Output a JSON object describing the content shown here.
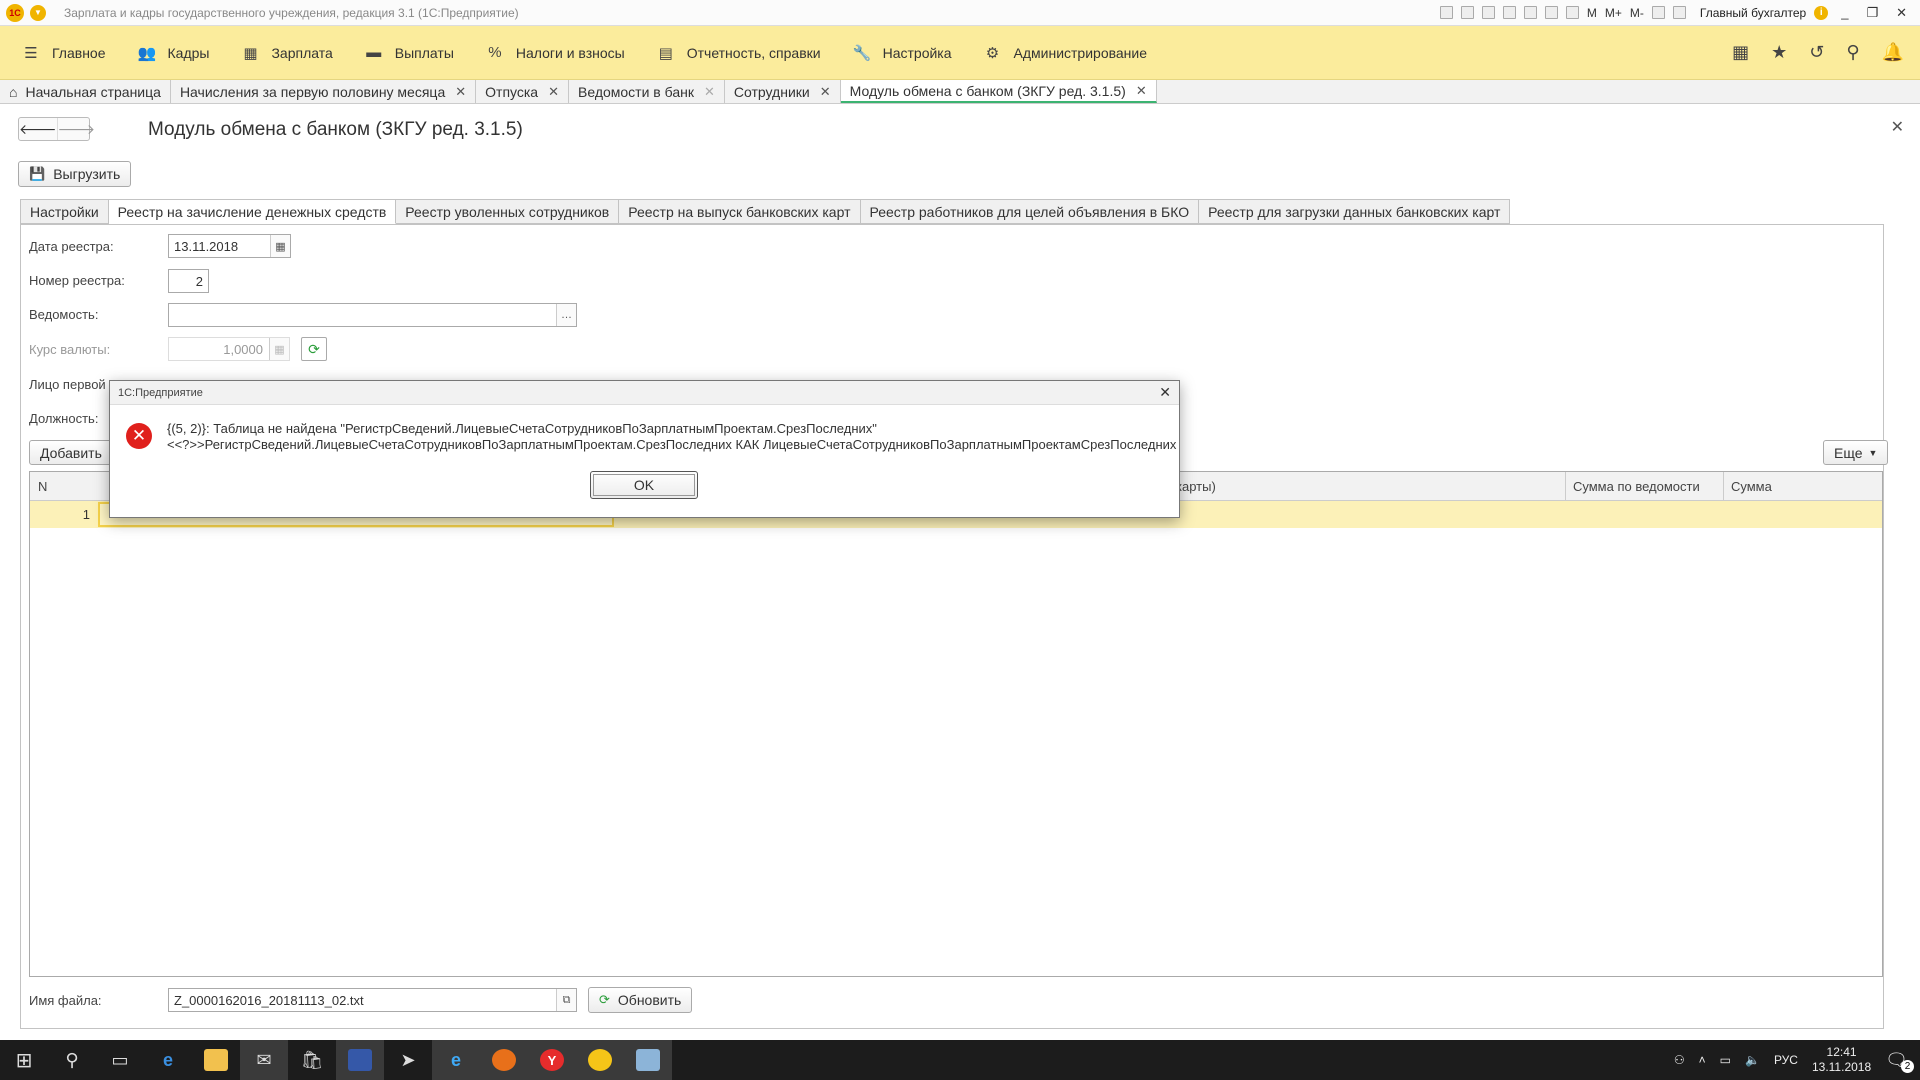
{
  "window": {
    "title": "Зарплата и кадры государственного учреждения, редакция 3.1  (1С:Предприятие)",
    "logo": "1С",
    "toolbar_letters": [
      "M",
      "M+",
      "M-"
    ],
    "user": "Главный бухгалтер",
    "info_glyph": "i",
    "controls": [
      "_",
      "❐",
      "✕"
    ]
  },
  "menubar": {
    "items": [
      {
        "icon": "☰",
        "label": "Главное"
      },
      {
        "icon": "👥",
        "label": "Кадры"
      },
      {
        "icon": "▦",
        "label": "Зарплата"
      },
      {
        "icon": "▬",
        "label": "Выплаты"
      },
      {
        "icon": "%",
        "label": "Налоги и взносы"
      },
      {
        "icon": "▤",
        "label": "Отчетность, справки"
      },
      {
        "icon": "🔧",
        "label": "Настройка"
      },
      {
        "icon": "⚙",
        "label": "Администрирование"
      }
    ],
    "right_icons": [
      "▦",
      "★",
      "↺",
      "⚲",
      "🔔"
    ]
  },
  "open_tabs": [
    {
      "label": "Начальная страница",
      "closable": false
    },
    {
      "label": "Начисления за первую половину месяца",
      "closable": true
    },
    {
      "label": "Отпуска",
      "closable": true
    },
    {
      "label": "Ведомости в банк",
      "closable": true
    },
    {
      "label": "Сотрудники",
      "closable": true
    },
    {
      "label": "Модуль обмена с банком (ЗКГУ ред. 3.1.5)",
      "closable": true
    }
  ],
  "form": {
    "title": "Модуль обмена с банком (ЗКГУ ред. 3.1.5)",
    "export_button": "Выгрузить",
    "tabs": [
      "Настройки",
      "Реестр на зачисление денежных средств",
      "Реестр уволенных сотрудников",
      "Реестр на выпуск банковских карт",
      "Реестр работников для целей объявления в БКО",
      "Реестр для загрузки данных банковских карт"
    ],
    "active_tab": 1,
    "fields": {
      "date_label": "Дата реестра:",
      "date_value": "13.11.2018",
      "number_label": "Номер реестра:",
      "number_value": "2",
      "statement_label": "Ведомость:",
      "statement_value": "",
      "rate_label": "Курс валюты:",
      "rate_value": "1,0000",
      "person_label": "Лицо первой",
      "position_label": "Должность:"
    },
    "add_button": "Добавить",
    "more_button": "Еще",
    "table": {
      "columns": [
        "N",
        "карты)",
        "Сумма по ведомости",
        "Сумма"
      ],
      "rows": [
        {
          "n": "1"
        }
      ]
    },
    "file_label": "Имя файла:",
    "file_value": "Z_0000162016_20181113_02.txt",
    "refresh_button": "Обновить"
  },
  "dialog": {
    "title": "1С:Предприятие",
    "message_line1": "{(5, 2)}: Таблица не найдена \"РегистрСведений.ЛицевыеСчетаСотрудниковПоЗарплатнымПроектам.СрезПоследних\"",
    "message_line2": "<<?>>РегистрСведений.ЛицевыеСчетаСотрудниковПоЗарплатнымПроектам.СрезПоследних КАК ЛицевыеСчетаСотрудниковПоЗарплатнымПроектамСрезПоследних",
    "ok_label": "OK"
  },
  "taskbar": {
    "language": "РУС",
    "time": "12:41",
    "date": "13.11.2018",
    "notifications": "2",
    "icons": [
      "windows-start",
      "search",
      "task-view",
      "edge",
      "file-explorer",
      "mail",
      "store",
      "save",
      "arrow",
      "ie",
      "firefox",
      "yandex",
      "1c",
      "notepad"
    ]
  }
}
